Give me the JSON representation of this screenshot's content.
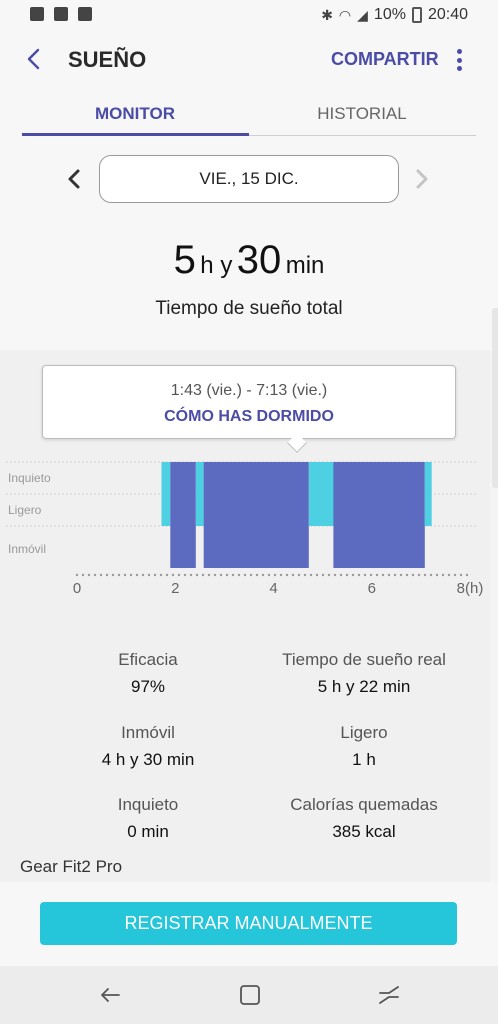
{
  "status_bar": {
    "battery": "10%",
    "time": "20:40"
  },
  "header": {
    "title": "SUEÑO",
    "share_label": "COMPARTIR"
  },
  "tabs": [
    {
      "label": "MONITOR"
    },
    {
      "label": "HISTORIAL"
    }
  ],
  "date": {
    "label": "VIE., 15 DIC."
  },
  "total_sleep": {
    "hours": "5",
    "h_unit": "h y",
    "minutes": "30",
    "min_unit": "min",
    "label": "Tiempo de sueño total"
  },
  "tooltip": {
    "range": "1:43 (vie.) - 7:13 (vie.)",
    "link": "CÓMO HAS DORMIDO"
  },
  "chart_data": {
    "type": "bar",
    "levels": [
      "Inquieto",
      "Ligero",
      "Inmóvil"
    ],
    "x_ticks": [
      "0",
      "2",
      "4",
      "6",
      "8(h)"
    ],
    "xlim": [
      0,
      8
    ],
    "segments": [
      {
        "start": 1.72,
        "end": 1.9,
        "level": "Ligero"
      },
      {
        "start": 1.9,
        "end": 2.42,
        "level": "Inmóvil"
      },
      {
        "start": 2.42,
        "end": 2.58,
        "level": "Ligero"
      },
      {
        "start": 2.58,
        "end": 4.72,
        "level": "Inmóvil"
      },
      {
        "start": 4.72,
        "end": 5.22,
        "level": "Ligero"
      },
      {
        "start": 5.22,
        "end": 7.08,
        "level": "Inmóvil"
      },
      {
        "start": 7.08,
        "end": 7.22,
        "level": "Ligero"
      }
    ],
    "colors": {
      "Inmóvil": "#5c6bc0",
      "Ligero": "#4dd0e1"
    }
  },
  "stats": [
    {
      "label": "Eficacia",
      "value": "97%"
    },
    {
      "label": "Tiempo de sueño real",
      "value": "5 h y 22 min"
    },
    {
      "label": "Inmóvil",
      "value": "4 h y 30 min"
    },
    {
      "label": "Ligero",
      "value": "1 h"
    },
    {
      "label": "Inquieto",
      "value": "0 min"
    },
    {
      "label": "Calorías quemadas",
      "value": "385 kcal"
    }
  ],
  "device": "Gear Fit2 Pro",
  "register_label": "REGISTRAR MANUALMENTE",
  "theme": {
    "accent": "#4a4ca5",
    "button": "#26c6da"
  }
}
